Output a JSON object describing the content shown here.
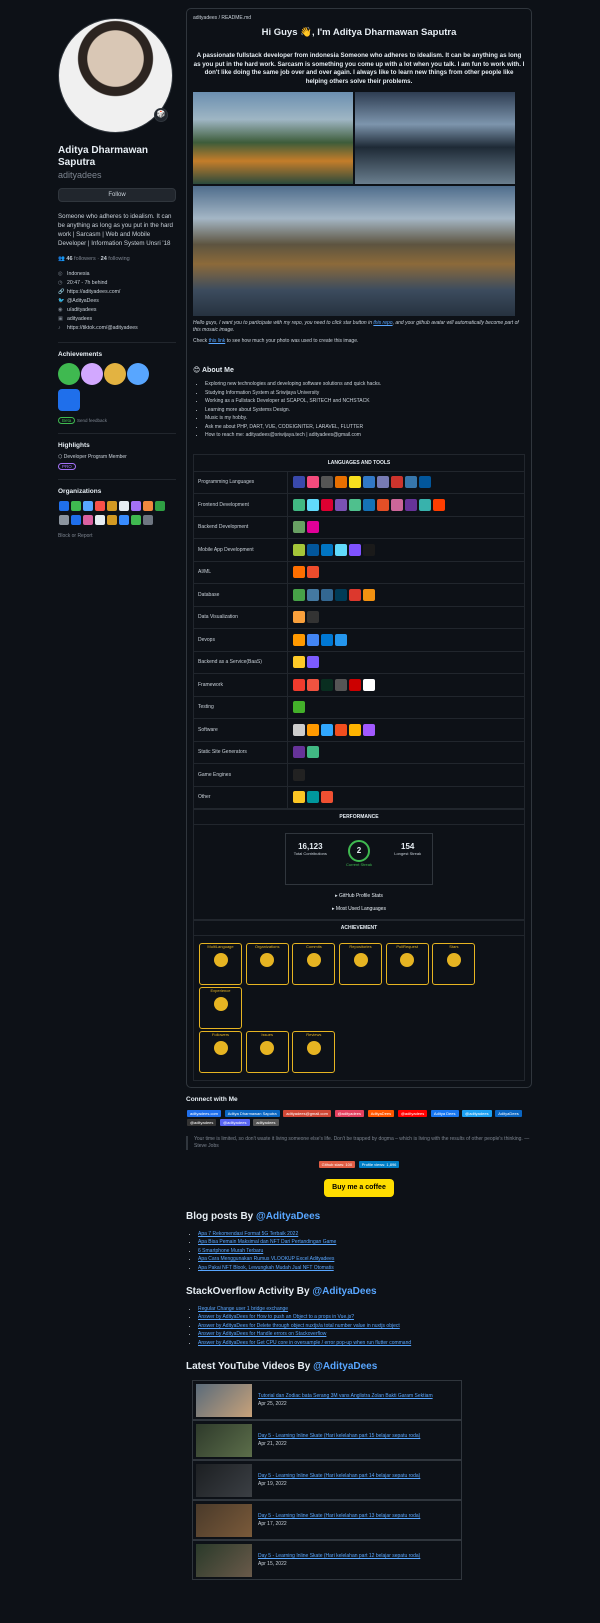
{
  "profile": {
    "name": "Aditya Dharmawan Saputra",
    "login": "adityadees",
    "follow_label": "Follow",
    "bio": "Someone who adheres to idealism. It can be anything as long as you put in the hard work | Sarcasm | Web and Mobile Developer | Information System Unsri '18",
    "followers": "46",
    "followers_label": "followers",
    "following": "24",
    "following_label": "following",
    "info": [
      "Indonesia",
      "20:47 - 7h behind",
      "https://adityadees.com/",
      "@AdityaDees",
      "u/adityadees",
      "adityadees",
      "https://tiktok.com/@adityadees"
    ],
    "achievements_title": "Achievements",
    "achievement_badge": "Beta",
    "achievement_feedback": "Send feedback",
    "highlights_title": "Highlights",
    "highlight_item": "Developer Program Member",
    "highlight_badge": "PRO",
    "orgs_title": "Organizations",
    "block_report": "Block or Report"
  },
  "readme": {
    "crumb": "adityadees / README.md",
    "title": "Hi Guys 👋, I'm Aditya Dharmawan Saputra",
    "intro": "A passionate fullstack developer from indonesia Someone who adheres to idealism. It can be anything as long as you put in the hard work. Sarcasm is something you come up with a lot when you talk. I am fun to work with. I don't like doing the same job over and over again. I always like to learn new things from other people like helping others solve their problems.",
    "caption_prefix": "Hello guys, I want you to participate with my repo, you need to click star button in ",
    "caption_link": "this repo",
    "caption_suffix": ", and your github avatar will automatically become part of this mosaic image.",
    "check_prefix": "Check ",
    "check_link": "this link",
    "check_suffix": " to see how much your photo was used to create this image."
  },
  "about": {
    "title": "About Me",
    "items": [
      "Exploring new technologies and developing software solutions and quick hacks.",
      "Studying Information System at Sriwijaya University",
      "Working as a Fullstack Developer at SCAPOL, SRITECH and NCHSTACK",
      "Learning more about Systems Design.",
      "Music is my hobby.",
      "Ask me about PHP, DART, VUE, CODEIGNITER, LARAVEL, FLUTTER",
      "How to reach me: adityadees@sriwijaya.tech | adityadees@gmail.com"
    ]
  },
  "tools": {
    "header": "LANGUAGES AND TOOLS",
    "rows": [
      {
        "label": "Programming Languages"
      },
      {
        "label": "Frontend Development"
      },
      {
        "label": "Backend Development"
      },
      {
        "label": "Mobile App Development"
      },
      {
        "label": "AI/ML"
      },
      {
        "label": "Database"
      },
      {
        "label": "Data Visualization"
      },
      {
        "label": "Devops"
      },
      {
        "label": "Backend as a Service(BaaS)"
      },
      {
        "label": "Framework"
      },
      {
        "label": "Testing"
      },
      {
        "label": "Software"
      },
      {
        "label": "Static Site Generators"
      },
      {
        "label": "Game Engines"
      },
      {
        "label": "Other"
      }
    ]
  },
  "performance": {
    "header": "PERFORMANCE",
    "total_contributions": "16,123",
    "total_label": "Total Contributions",
    "current_streak": "2",
    "current_label": "Current Streak",
    "longest_streak": "154",
    "longest_label": "Longest Streak",
    "details": [
      "▸ GitHub Profile Stats",
      "▸ Most Used Languages"
    ]
  },
  "achievement": {
    "header": "ACHIEVEMENT",
    "trophies": [
      "MultiLanguage",
      "Organizations",
      "Commits",
      "Repositories",
      "PullRequest",
      "Stars",
      "Experience",
      "Followers",
      "Issues",
      "Reviews"
    ]
  },
  "connect": {
    "title": "Connect with Me",
    "shields": [
      "adityadees.com",
      "Aditya Dharmawan Saputra",
      "adityadees@gmail.com",
      "@adityadees",
      "AdityaDees",
      "@adityadees",
      "Aditya Dees",
      "@adityadees",
      "AdityaDees",
      "@adityadees",
      "@adityadees",
      "adityadees"
    ],
    "quote": "Your time is limited, so don't waste it living someone else's life. Don't be trapped by dogma – which is living with the results of other people's thinking. — Steve Jobs",
    "counters": [
      "Github stars: 100",
      "Profile views: 1,896"
    ],
    "coffee": "Buy me a coffee"
  },
  "blog": {
    "title_prefix": "Blog posts By ",
    "title_user": "@AdityaDees",
    "items": [
      "Apa 7 Rekomendasi Format 5G Terbaik 2022",
      "Apa Bisa Pemain Maksimal dan NFT Dari Pertandingan Game",
      "6 Smartphone Murah Terbaru",
      "Apa Cara Menggunakan Rumus VLOOKUP Excel Adityadees",
      "Apa Pakai NFT Blook, Lewungkah Mudah Jual NFT Otomatis"
    ]
  },
  "stackoverflow": {
    "title_prefix": "StackOverflow Activity By ",
    "title_user": "@AdityaDees",
    "items": [
      "Regular Change user 1 bridge exchange",
      "Answer by AdityaDees for How to push an Object to a props in Vue.js?",
      "Answer by AdityaDees for Delete through object nuxtjs/a total number value in nuxtjs object",
      "Answer by AdityaDees for Handle errors on Stackoverflow",
      "Answer by AdityaDees for Get CPU core in oversample / error pop-up when run flutter command"
    ]
  },
  "youtube": {
    "title_prefix": "Latest YouTube Videos By ",
    "title_user": "@AdityaDees",
    "items": [
      {
        "title": "Tutorial dan Zodiac bata Serang 3M vans Anglistra Zolan Bakti Garam Sektiam",
        "date": "Apr 25, 2022"
      },
      {
        "title": "Day 5 - Learning Inline Skate (Hari kelelahan part 15 belajar sepatu roda)",
        "date": "Apr 21, 2022"
      },
      {
        "title": "Day 5 - Learning Inline Skate (Hari kelelahan part 14 belajar sepatu roda)",
        "date": "Apr 19, 2022"
      },
      {
        "title": "Day 5 - Learning Inline Skate (Hari kelelahan part 13 belajar sepatu roda)",
        "date": "Apr 17, 2022"
      },
      {
        "title": "Day 5 - Learning Inline Skate (Hari kelelahan part 12 belajar sepatu roda)",
        "date": "Apr 15, 2022"
      }
    ]
  }
}
